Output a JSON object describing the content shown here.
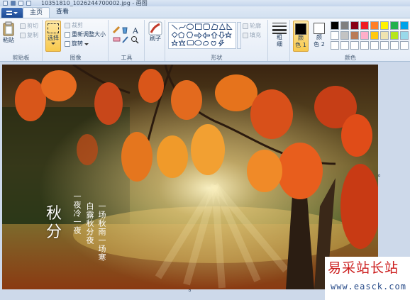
{
  "window": {
    "title": "10351810_1026244700002.jpg - 画图"
  },
  "tabs": [
    {
      "label": "主页",
      "active": true
    },
    {
      "label": "查看",
      "active": false
    }
  ],
  "ribbon": {
    "clipboard": {
      "paste_label": "粘贴",
      "cut_label": "剪切",
      "copy_label": "复制",
      "group_label": "剪贴板"
    },
    "image": {
      "select_label": "选择",
      "crop_label": "裁剪",
      "resize_label": "重新调整大小",
      "rotate_label": "旋转",
      "group_label": "图像"
    },
    "tools": {
      "group_label": "工具",
      "text_tool_glyph": "A"
    },
    "brushes": {
      "label": "刷子"
    },
    "shapes": {
      "outline_label": "轮廓",
      "fill_label": "填充",
      "group_label": "形状"
    },
    "size": {
      "label_line1": "粗",
      "label_line2": "细"
    },
    "colors": {
      "color1_line1": "颜",
      "color1_line2": "色 1",
      "color2_line1": "颜",
      "color2_line2": "色 2",
      "group_label": "颜色",
      "color1_value": "#000000",
      "color2_value": "#ffffff",
      "palette": [
        "#000000",
        "#7f7f7f",
        "#880015",
        "#ed1c24",
        "#ff7f27",
        "#fff200",
        "#22b14c",
        "#00a2e8",
        "#ffffff",
        "#c3c3c3",
        "#b97a57",
        "#ffaec9",
        "#ffc90e",
        "#efe4b0",
        "#b5e61d",
        "#99d9ea",
        "#ffffff",
        "#ffffff",
        "#ffffff",
        "#ffffff",
        "#ffffff",
        "#ffffff",
        "#ffffff",
        "#ffffff"
      ]
    }
  },
  "canvas": {
    "poem_title_1": "秋",
    "poem_title_2": "分",
    "poem_col_1": "一场秋雨一场寒",
    "poem_col_2": "白露秋分夜",
    "poem_col_3": "一夜冷一夜"
  },
  "watermark": {
    "title": "易采站长站",
    "url": "www.easck.com"
  }
}
